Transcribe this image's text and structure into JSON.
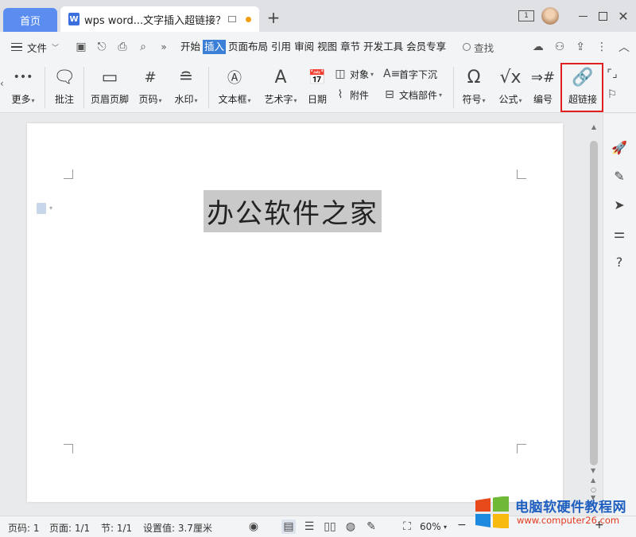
{
  "titlebar": {
    "home_tab": "首页",
    "doc_tab_title": "wps word...文字插入超链接？",
    "doc_tab_icon": "W",
    "new_tab": "+",
    "window_badge": "1"
  },
  "menubar": {
    "file": "文件",
    "tabs": [
      "开始",
      "插入",
      "页面布局",
      "引用",
      "审阅",
      "视图",
      "章节",
      "开发工具",
      "会员专享"
    ],
    "active_tab": "插入",
    "search": "查找"
  },
  "ribbon": {
    "more": "更多",
    "comment": "批注",
    "header_footer": "页眉页脚",
    "page_number": "页码",
    "watermark": "水印",
    "textbox": "文本框",
    "wordart": "艺术字",
    "date": "日期",
    "object": "对象",
    "attachment": "附件",
    "drop_cap": "首字下沉",
    "doc_parts": "文档部件",
    "symbol": "符号",
    "formula": "公式",
    "numbering": "编号",
    "hyperlink": "超链接"
  },
  "document": {
    "text": "办公软件之家"
  },
  "statusbar": {
    "page_num": "页码: 1",
    "page_of": "页面: 1/1",
    "section": "节: 1/1",
    "setting": "设置值: 3.7厘米",
    "zoom": "60%"
  },
  "watermark_brand": {
    "name": "电脑软硬件教程网",
    "url": "www.computer26.com"
  },
  "colors": {
    "accent": "#5b8df0",
    "active_tab": "#3c7fd7",
    "highlight_box": "#e02020"
  }
}
